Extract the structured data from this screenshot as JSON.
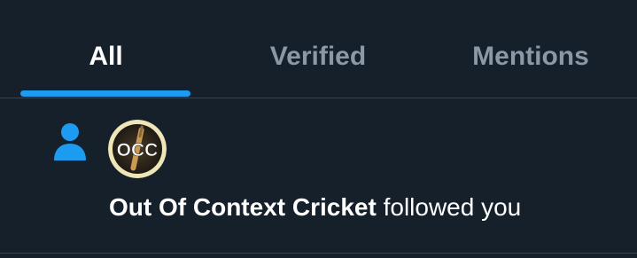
{
  "tabs": [
    {
      "label": "All",
      "active": true
    },
    {
      "label": "Verified",
      "active": false
    },
    {
      "label": "Mentions",
      "active": false
    }
  ],
  "notification": {
    "icon": "person-icon",
    "avatar_text": "OCC",
    "actor_name": "Out Of Context Cricket",
    "action_text": "followed you"
  },
  "colors": {
    "background": "#15202b",
    "accent": "#1d9bf0",
    "active_text": "#ffffff",
    "inactive_text": "#8b98a5",
    "divider": "#38444d"
  }
}
